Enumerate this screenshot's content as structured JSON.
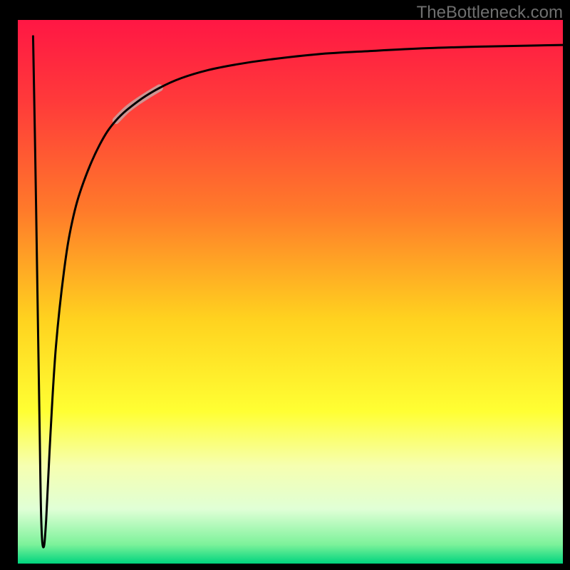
{
  "watermark": "TheBottleneck.com",
  "chart_data": {
    "type": "line",
    "title": "",
    "xlabel": "",
    "ylabel": "",
    "xlim": [
      0,
      100
    ],
    "ylim": [
      0,
      100
    ],
    "background_gradient": {
      "axis": "y",
      "stops": [
        {
          "t": 0.0,
          "color": "#ff1744"
        },
        {
          "t": 0.15,
          "color": "#ff3a3a"
        },
        {
          "t": 0.35,
          "color": "#ff7a2a"
        },
        {
          "t": 0.55,
          "color": "#ffd21f"
        },
        {
          "t": 0.72,
          "color": "#ffff33"
        },
        {
          "t": 0.82,
          "color": "#f6ffb0"
        },
        {
          "t": 0.9,
          "color": "#e0ffd6"
        },
        {
          "t": 0.965,
          "color": "#7cf29a"
        },
        {
          "t": 1.0,
          "color": "#00d47e"
        }
      ]
    },
    "series": [
      {
        "name": "curve",
        "color": "#000000",
        "x": [
          2.8,
          3.2,
          3.6,
          4.0,
          4.3,
          4.7,
          5.2,
          6.0,
          7.0,
          8.5,
          10,
          12,
          15,
          18,
          22,
          26,
          30,
          35,
          40,
          46,
          55,
          65,
          75,
          85,
          95,
          100
        ],
        "y": [
          97,
          75,
          50,
          25,
          8,
          3,
          8,
          24,
          40,
          54,
          63,
          70,
          77,
          81.5,
          85,
          87.5,
          89.3,
          90.8,
          91.8,
          92.7,
          93.7,
          94.3,
          94.8,
          95.1,
          95.3,
          95.4
        ]
      },
      {
        "name": "highlight-segment",
        "color": "#cf9492",
        "width": 10,
        "x": [
          18,
          20,
          22,
          24,
          26
        ],
        "y": [
          81.5,
          83.5,
          85,
          86.3,
          87.5
        ]
      }
    ],
    "minimum_point": {
      "x": 4.3,
      "y": 3
    }
  }
}
